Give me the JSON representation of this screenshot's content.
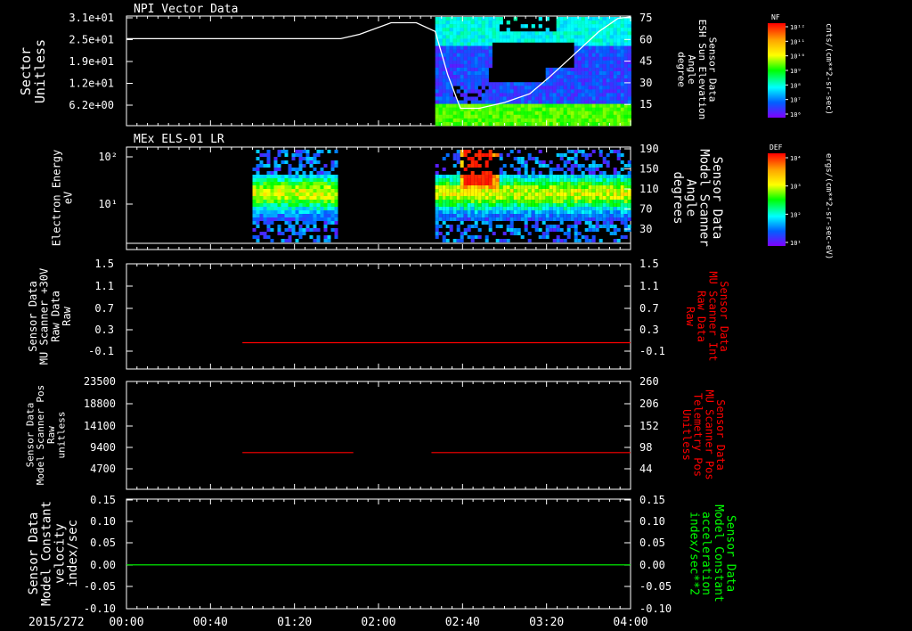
{
  "date_label": "2015/272",
  "time_ticks": [
    "00:00",
    "00:40",
    "01:20",
    "02:00",
    "02:40",
    "03:20",
    "04:00"
  ],
  "colors": {
    "background": "#000000",
    "axis": "#ffffff",
    "red_trace": "#ff0000",
    "green_trace": "#00ff00"
  },
  "chart_data": [
    {
      "type": "heatmap",
      "panel": "npi",
      "title": "NPI Vector Data",
      "ylabel": [
        "Sector",
        "Unitless"
      ],
      "yticks": [
        "3.1e+01",
        "2.5e+01",
        "1.9e+01",
        "1.2e+01",
        "6.2e+00"
      ],
      "y2label": [
        "Sensor Data",
        "ESH Sun Elevation",
        "Angle",
        "degree"
      ],
      "y2ticks": [
        75,
        60,
        45,
        30,
        15
      ],
      "y2lim": [
        0,
        75
      ],
      "colorbar": {
        "label": "NF",
        "units": "cnts/(cm**2-sr-sec)",
        "ticks": [
          "10¹²",
          "10¹¹",
          "10¹⁰",
          "10⁹",
          "10⁸",
          "10⁷",
          "10⁶"
        ]
      },
      "line_series": {
        "name": "ESH Sun Elevation Angle",
        "x_hours": [
          0.0,
          1.7,
          1.85,
          2.1,
          2.3,
          2.45,
          2.55,
          2.65,
          2.8,
          3.0,
          3.2,
          3.35,
          3.5,
          3.75,
          3.9,
          4.0
        ],
        "values": [
          60,
          60,
          63,
          71,
          71,
          65,
          35,
          12,
          12,
          16,
          22,
          33,
          45,
          65,
          74,
          75
        ]
      },
      "data_start_hours": 2.45
    },
    {
      "type": "heatmap",
      "panel": "els",
      "title": "MEx ELS-01 LR",
      "ylabel": [
        "Electron Energy",
        "eV"
      ],
      "yticks": [
        "10²",
        "10¹"
      ],
      "y2label": [
        "Sensor Data",
        "Model Scanner",
        "Angle",
        "degrees"
      ],
      "y2ticks": [
        190,
        150,
        110,
        70,
        30
      ],
      "colorbar": {
        "label": "DEF",
        "units": "ergs/(cm**2-sr-sec-eV)",
        "ticks": [
          "10⁴",
          "10³",
          "10²",
          "10¹"
        ]
      },
      "intervals_hours": [
        [
          1.0,
          1.67
        ],
        [
          2.45,
          4.0
        ]
      ],
      "burst_hours": [
        2.67,
        2.9
      ],
      "scanner_angle_line": 17
    },
    {
      "type": "line",
      "panel": "mu30",
      "ylabel": [
        "Sensor Data",
        "MU Scanner +30V",
        "Raw Data",
        "Raw"
      ],
      "yticks": [
        "1.5",
        "1.1",
        "0.7",
        "0.3",
        "-0.1"
      ],
      "ylim": [
        -0.5,
        1.5
      ],
      "y2label": [
        "Sensor Data",
        "MU Scanner Int",
        "Raw Data",
        "Raw"
      ],
      "y2ticks": [
        "1.5",
        "1.1",
        "0.7",
        "0.3",
        "-0.1"
      ],
      "series": [
        {
          "name": "MU Scanner Int Raw Data",
          "color": "#ff0000",
          "segments": [
            [
              0.92,
              4.0,
              0.0
            ]
          ]
        }
      ]
    },
    {
      "type": "line",
      "panel": "pos",
      "ylabel": [
        "Sensor Data",
        "Model Scanner Pos",
        "Raw",
        "unitless"
      ],
      "yticks": [
        "23500",
        "18800",
        "14100",
        "9400",
        "4700"
      ],
      "ylim": [
        0,
        23500
      ],
      "y2label": [
        "Sensor Data",
        "MU Scanner Pos",
        "Telemetry Pos",
        "Unitless"
      ],
      "y2ticks": [
        "260",
        "206",
        "152",
        "98",
        "44"
      ],
      "series": [
        {
          "name": "MU Scanner Pos Telemetry",
          "color": "#ff0000",
          "segments": [
            [
              0.92,
              1.8,
              8000
            ],
            [
              2.42,
              4.0,
              8000
            ]
          ]
        }
      ]
    },
    {
      "type": "line",
      "panel": "vel",
      "ylabel": [
        "Sensor Data",
        "Model Constant",
        "velocity",
        "index/sec"
      ],
      "yticks": [
        "0.15",
        "0.10",
        "0.05",
        "0.00",
        "-0.05",
        "-0.10"
      ],
      "ylim": [
        -0.1,
        0.15
      ],
      "y2label": [
        "Sensor Data",
        "Model Constant",
        "acceleration",
        "index/sec**2"
      ],
      "y2ticks": [
        "0.15",
        "0.10",
        "0.05",
        "0.00",
        "-0.05",
        "-0.10"
      ],
      "series": [
        {
          "name": "Model Constant acceleration",
          "color": "#00ff00",
          "segments": [
            [
              0.0,
              4.0,
              0.0
            ]
          ]
        }
      ]
    }
  ]
}
